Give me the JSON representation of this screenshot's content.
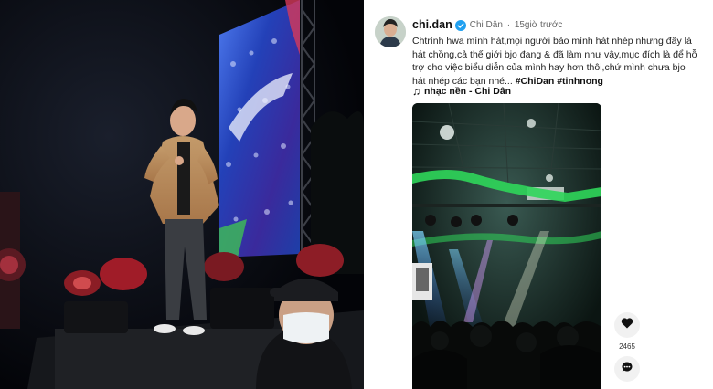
{
  "post": {
    "username": "chi.dan",
    "display_name": "Chi Dân",
    "separator": "·",
    "time": "15giờ trước",
    "caption_text": "Chtrình hwa mình hát,mọi người bảo mình hát nhép nhưng đây là hát chồng,cả thế giới bjo đang & đã làm như vậy,mục đích là để hỗ trợ cho việc biểu diễn của mình hay hơn thôi,chứ mình chưa bjo hát nhép các bạn nhé...",
    "hashtags": [
      "#ChiDan",
      "#tinhnong"
    ],
    "music_icon": "♫",
    "music_label": "nhạc nền - Chi Dân",
    "like_count": "2465"
  },
  "icons": {
    "verified": "verified-badge-icon",
    "like": "heart-icon",
    "comment": "comment-bubble-icon"
  },
  "colors": {
    "verified": "#20a0f0",
    "stage_green": "#2fd65a",
    "led_blue": "#2a56d6"
  }
}
